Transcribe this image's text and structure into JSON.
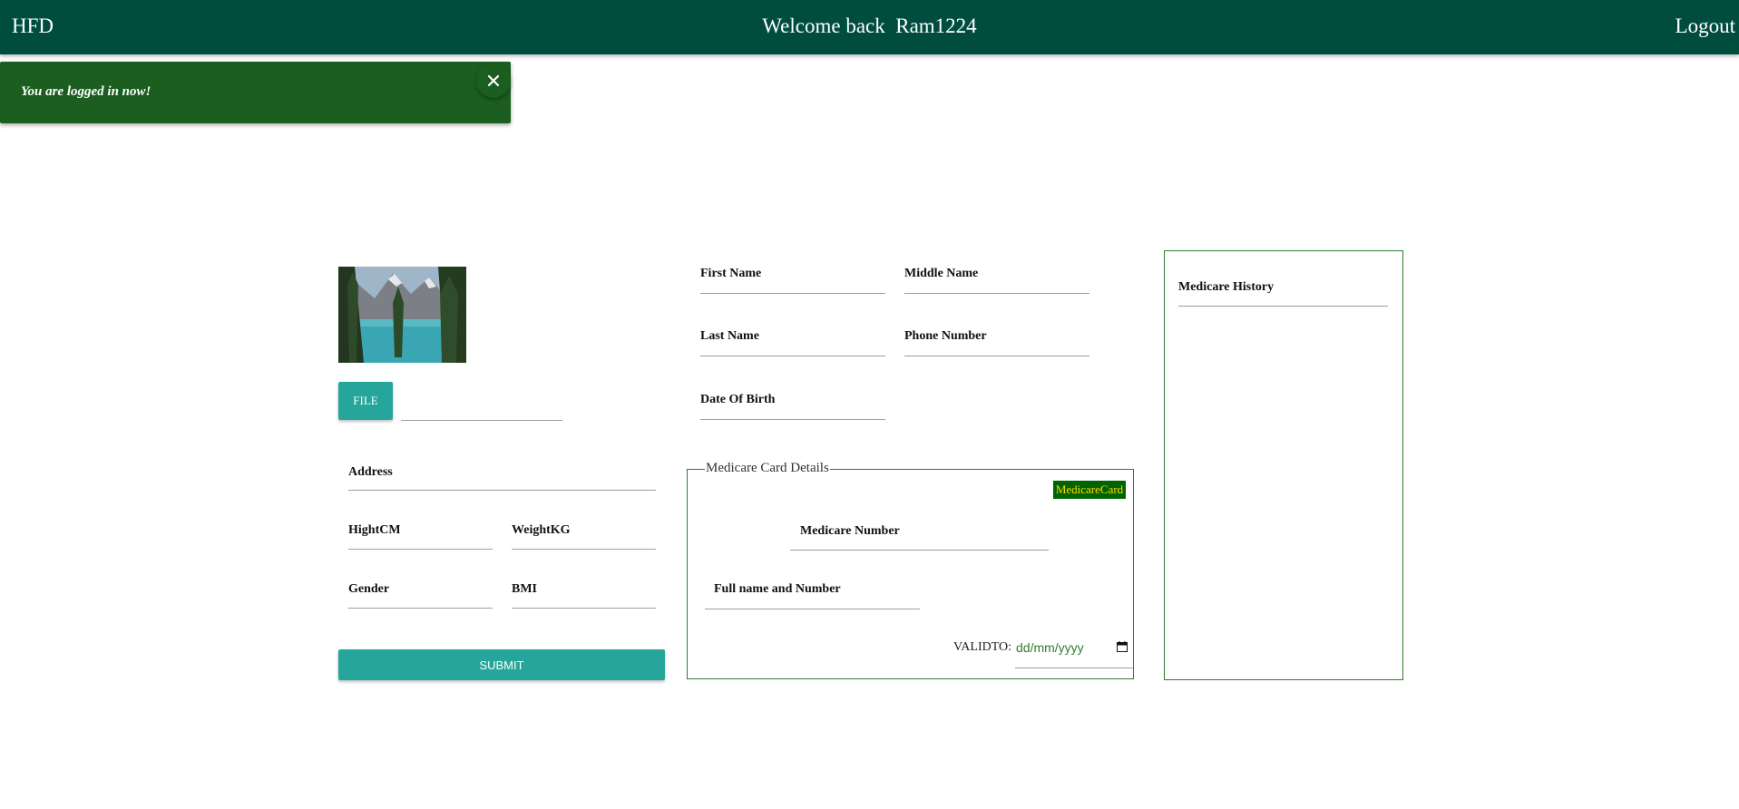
{
  "header": {
    "brand": "HFD",
    "welcome": "Welcome back  Ram1224",
    "logout": "Logout"
  },
  "toast": {
    "message": "You are logged in now!",
    "close_icon": "close-icon"
  },
  "left_form": {
    "file_button": "FILE",
    "address": "Address",
    "height": "HightCM",
    "weight": "WeightKG",
    "gender": "Gender",
    "bmi": "BMI",
    "submit": "SUBMIT"
  },
  "personal": {
    "first_name": "First Name",
    "middle_name": "Middle Name",
    "last_name": "Last Name",
    "phone": "Phone Number",
    "dob": "Date Of Birth"
  },
  "medicare": {
    "legend": "Medicare Card Details",
    "badge": "MedicareCard",
    "number": "Medicare Number",
    "full_name": "Full name and Number",
    "validto_label": "VALIDTO:",
    "validto_placeholder": "dd/mm/yyyy"
  },
  "history": {
    "title": "Medicare History"
  },
  "colors": {
    "header_bg": "#004d40",
    "toast_bg": "#1b5e20",
    "button_teal": "#26a69a",
    "border_green": "#2e7d32",
    "badge_bg": "#006400",
    "badge_text": "#ffd700"
  }
}
